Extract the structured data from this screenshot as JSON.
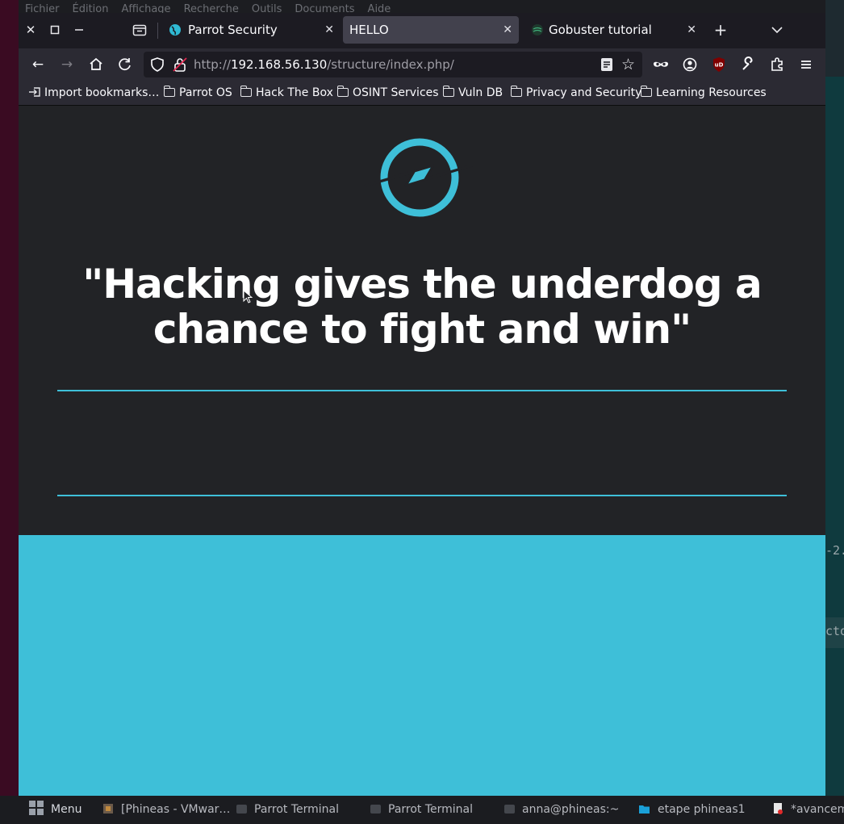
{
  "desktop_menu": [
    "Fichier",
    "Édition",
    "Affichage",
    "Recherche",
    "Outils",
    "Documents",
    "Aide"
  ],
  "terminal_right": {
    "line1": "-2.",
    "line2": "cto"
  },
  "tabs": [
    {
      "label": "Parrot Security",
      "active": false
    },
    {
      "label": "HELLO",
      "active": true
    },
    {
      "label": "Gobuster tutorial",
      "active": false
    }
  ],
  "url": {
    "prefix": "http://",
    "host": "192.168.56.130",
    "path": "/structure/index.php/"
  },
  "bookmarks": [
    {
      "label": "Import bookmarks…",
      "icon": "import-icon"
    },
    {
      "label": "Parrot OS",
      "icon": "folder-icon"
    },
    {
      "label": "Hack The Box",
      "icon": "folder-icon"
    },
    {
      "label": "OSINT Services",
      "icon": "folder-icon"
    },
    {
      "label": "Vuln DB",
      "icon": "folder-icon"
    },
    {
      "label": "Privacy and Security",
      "icon": "folder-icon"
    },
    {
      "label": "Learning Resources",
      "icon": "folder-icon"
    }
  ],
  "page": {
    "quote": "\"Hacking gives the underdog a chance to fight and win\"",
    "accent_color": "#3ebfd8",
    "dark_bg": "#222326"
  },
  "taskbar": {
    "menu_label": "Menu",
    "items": [
      {
        "label": "[Phineas - VMwar…",
        "icon": "vmware-icon"
      },
      {
        "label": "Parrot Terminal",
        "icon": "terminal-icon"
      },
      {
        "label": "Parrot Terminal",
        "icon": "terminal-icon"
      },
      {
        "label": "anna@phineas:~",
        "icon": "terminal-icon"
      },
      {
        "label": "etape phineas1",
        "icon": "folder-icon"
      },
      {
        "label": "*avancem",
        "icon": "text-editor-icon"
      }
    ]
  }
}
